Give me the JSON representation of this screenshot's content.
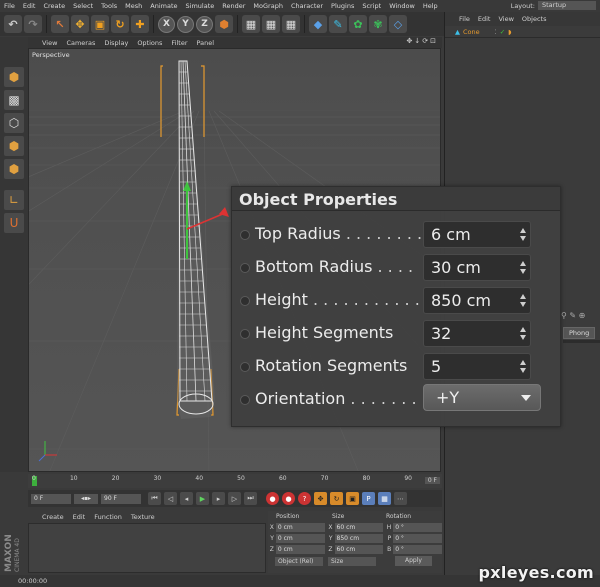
{
  "menubar": {
    "items": [
      "File",
      "Edit",
      "Create",
      "Select",
      "Tools",
      "Mesh",
      "Animate",
      "Simulate",
      "Render",
      "MoGraph",
      "Character",
      "Plugins",
      "Script",
      "Window",
      "Help"
    ],
    "layout_label": "Layout:",
    "layout_value": "Startup"
  },
  "toolbar": {
    "axis_x": "X",
    "axis_y": "Y",
    "axis_z": "Z"
  },
  "object_manager": {
    "menu": [
      "File",
      "Edit",
      "View",
      "Objects"
    ],
    "object_name": "Cone",
    "material_tag": "Phong"
  },
  "viewport": {
    "menu": [
      "View",
      "Cameras",
      "Display",
      "Options",
      "Filter",
      "Panel"
    ],
    "label": "Perspective"
  },
  "timeline": {
    "ticks": [
      "0",
      "10",
      "20",
      "30",
      "40",
      "50",
      "60",
      "70",
      "80",
      "90"
    ],
    "end_field": "0 F",
    "current_frame": "0 F",
    "end_frame": "90 F"
  },
  "material_manager": {
    "menu": [
      "Create",
      "Edit",
      "Function",
      "Texture"
    ]
  },
  "branding": {
    "maxon": "MAXON",
    "product": "CINEMA 4D"
  },
  "coordinates": {
    "headers": [
      "Position",
      "Size",
      "Rotation"
    ],
    "rows": [
      {
        "axis": "X",
        "pos": "0 cm",
        "size_axis": "X",
        "size": "60 cm",
        "rot_axis": "H",
        "rot": "0 °"
      },
      {
        "axis": "Y",
        "pos": "0 cm",
        "size_axis": "Y",
        "size": "850 cm",
        "rot_axis": "P",
        "rot": "0 °"
      },
      {
        "axis": "Z",
        "pos": "0 cm",
        "size_axis": "Z",
        "size": "60 cm",
        "rot_axis": "B",
        "rot": "0 °"
      }
    ],
    "mode": "Object (Rel)",
    "size_mode": "Size",
    "apply": "Apply"
  },
  "status": "00:00:00",
  "watermark": "pxleyes.com",
  "object_properties": {
    "title": "Object Properties",
    "rows": [
      {
        "label": "Top Radius",
        "dots": " . . . . . . . .",
        "value": "6 cm",
        "kind": "spinner"
      },
      {
        "label": "Bottom Radius",
        "dots": " . . . .",
        "value": "30 cm",
        "kind": "spinner"
      },
      {
        "label": "Height",
        "dots": " . . . . . . . . . . .",
        "value": "850 cm",
        "kind": "spinner"
      },
      {
        "label": "Height Segments",
        "dots": "",
        "value": "32",
        "kind": "spinner"
      },
      {
        "label": "Rotation Segments",
        "dots": "",
        "value": "5",
        "kind": "spinner"
      },
      {
        "label": "Orientation",
        "dots": " . . . . . . . .",
        "value": "+Y",
        "kind": "dropdown"
      }
    ]
  },
  "colors": {
    "selection_orange": "#e59a2f",
    "axis_green": "#3fc43f",
    "axis_red": "#d33",
    "axis_blue": "#4b6fd6"
  }
}
